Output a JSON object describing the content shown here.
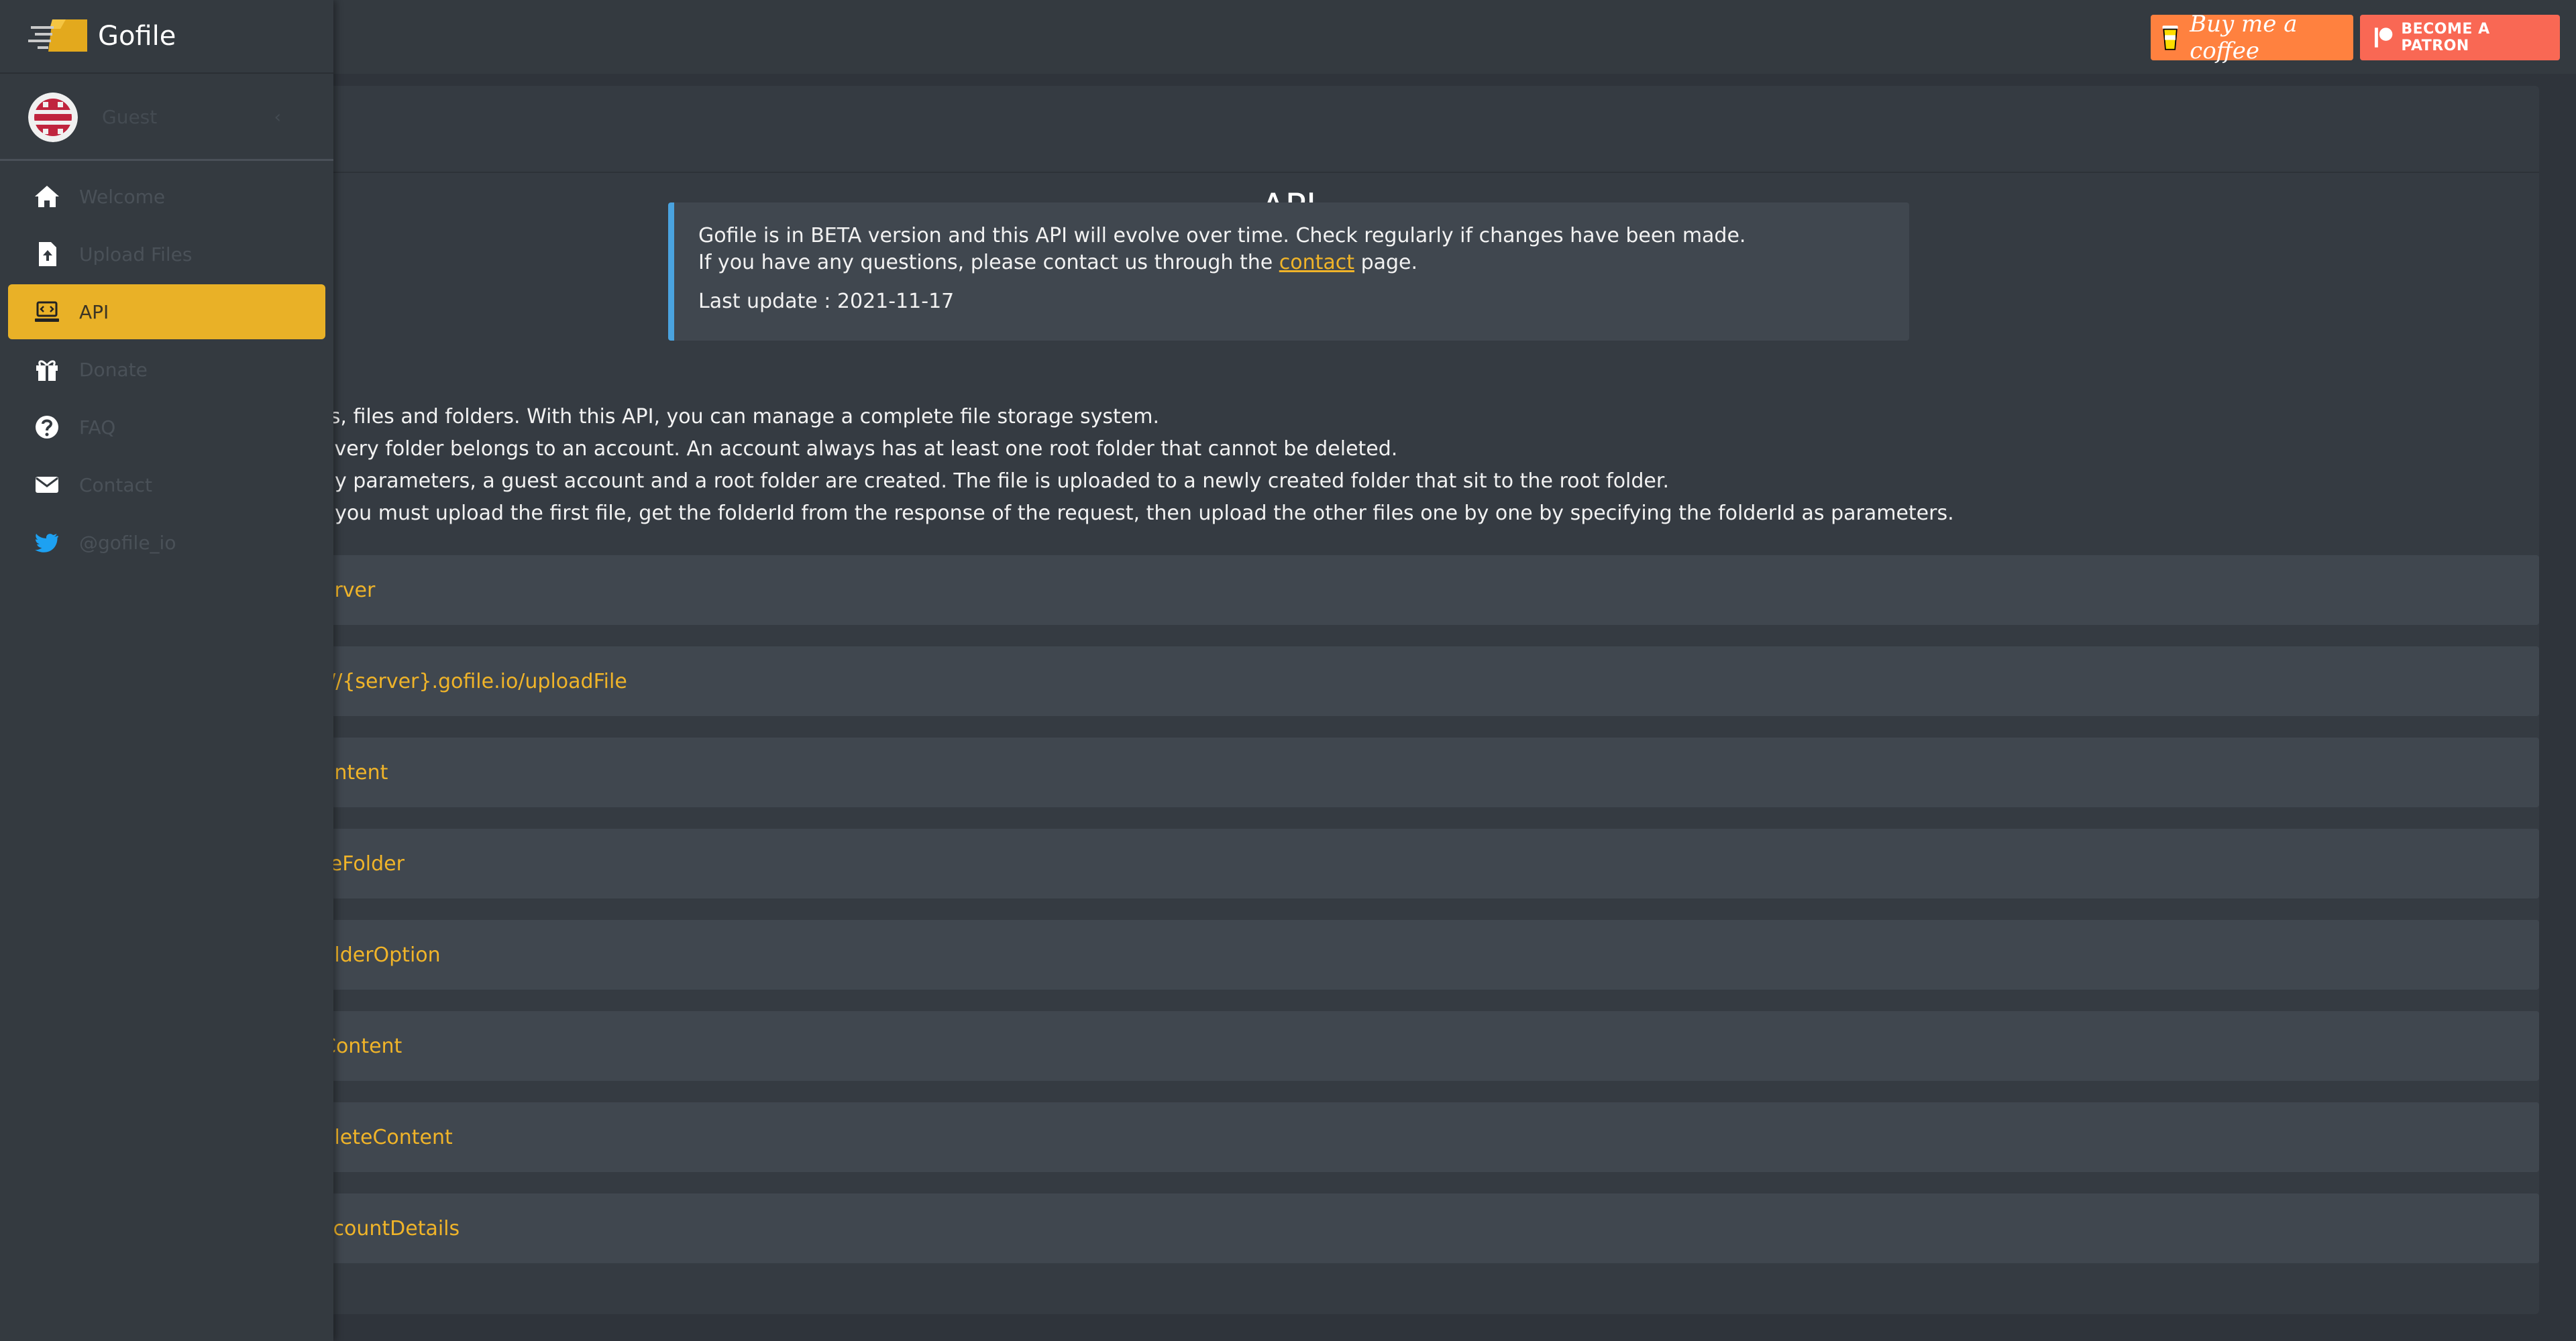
{
  "sidebar": {
    "brand": "Gofile",
    "user": {
      "name": "Guest"
    },
    "items": [
      {
        "label": "Welcome",
        "icon": "home-icon"
      },
      {
        "label": "Upload Files",
        "icon": "file-upload-icon"
      },
      {
        "label": "API",
        "icon": "laptop-code-icon",
        "active": true
      },
      {
        "label": "Donate",
        "icon": "gift-icon"
      },
      {
        "label": "FAQ",
        "icon": "question-icon"
      },
      {
        "label": "Contact",
        "icon": "envelope-icon"
      },
      {
        "label": "@gofile_io",
        "icon": "twitter-icon"
      }
    ]
  },
  "topbar": {
    "coffee_label": "Buy me a coffee",
    "patron_label": "BECOME A PATRON"
  },
  "main": {
    "title": "API",
    "info": {
      "line1": "Gofile is in BETA version and this API will evolve over time. Check regularly if changes have been made.",
      "line2_pre": "If you have any questions, please contact us through the ",
      "line2_link": "contact",
      "line2_post": " page.",
      "last_update": "Last update : 2021-11-17"
    },
    "intro": [
      "ts, files and folders. With this API, you can manage a complete file storage system.",
      "every folder belongs to an account. An account always has at least one root folder that cannot be deleted.",
      "ny parameters, a guest account and a root folder are created. The file is uploaded to a newly created folder that sit to the root folder.",
      ", you must upload the first file, get the folderId from the response of the request, then upload the other files one by one by specifying the folderId as parameters."
    ],
    "endpoints": [
      "erver",
      "://{server}.gofile.io/uploadFile",
      "ontent",
      "teFolder",
      "olderOption",
      "Content",
      "eleteContent",
      "ccountDetails"
    ]
  },
  "colors": {
    "accent": "#e9b127",
    "link": "#f0b429",
    "info_border": "#4aa3df",
    "coffee": "#ff813f",
    "patreon": "#f96854"
  }
}
